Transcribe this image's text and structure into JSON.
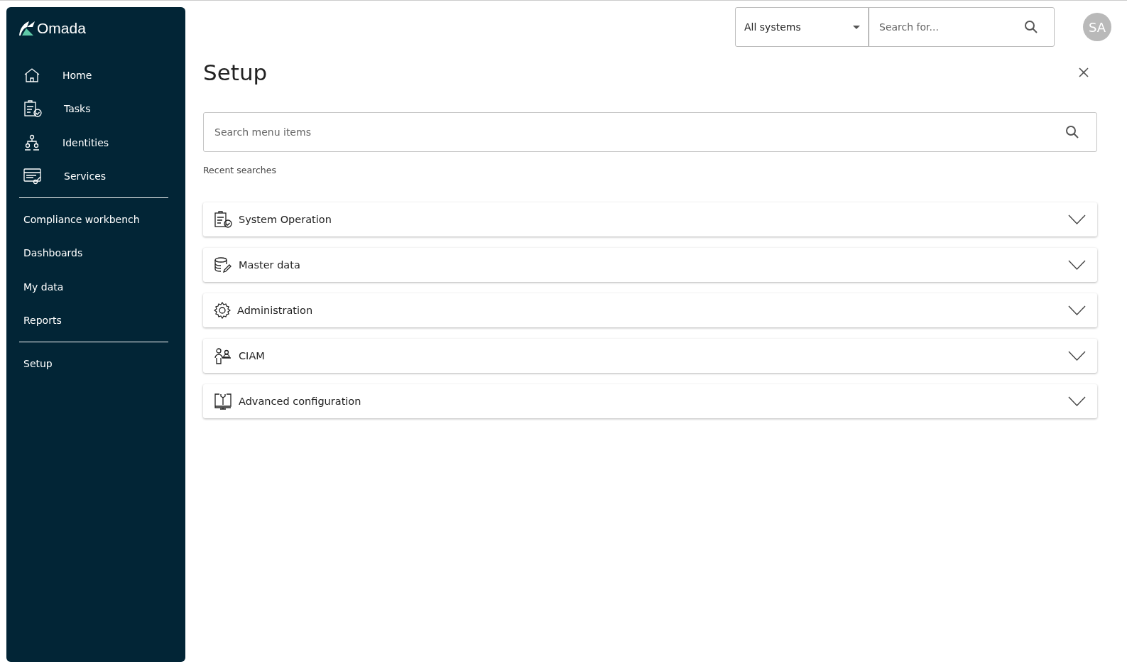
{
  "sidebar": {
    "logo": "Omada",
    "groups": [
      {
        "items": [
          {
            "label": "Home"
          },
          {
            "label": "Tasks"
          },
          {
            "label": "Identities"
          },
          {
            "label": "Services"
          }
        ]
      },
      {
        "items": [
          {
            "label": "Compliance workbench"
          },
          {
            "label": "Dashboards"
          },
          {
            "label": "My data"
          },
          {
            "label": "Reports"
          }
        ]
      },
      {
        "items": [
          {
            "label": "Setup"
          }
        ]
      }
    ]
  },
  "topbar": {
    "system_select": {
      "value": "All systems"
    },
    "search": {
      "placeholder": "Search for..."
    },
    "avatar": "SA"
  },
  "page": {
    "title": "Setup",
    "menu_search": {
      "placeholder": "Search menu items"
    },
    "recent_label": "Recent searches",
    "sections": [
      {
        "label": "System Operation",
        "expanded": false
      },
      {
        "label": "Master data",
        "expanded": false
      },
      {
        "label": "Administration",
        "expanded": false
      },
      {
        "label": "CIAM",
        "expanded": false
      },
      {
        "label": "Advanced configuration",
        "expanded": false
      }
    ]
  }
}
